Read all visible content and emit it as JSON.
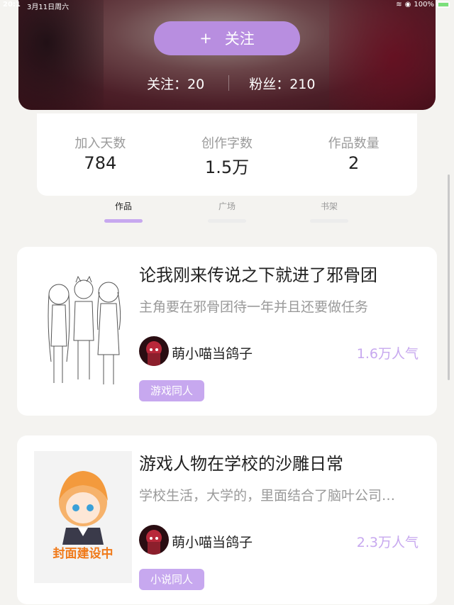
{
  "status": {
    "time": "20:1",
    "date": "3月11日周六",
    "battery": "100%"
  },
  "profile": {
    "follow_button": "关注",
    "following_label": "关注：20",
    "followers_label": "粉丝：210"
  },
  "stats": [
    {
      "label": "加入天数",
      "value": "784"
    },
    {
      "label": "创作字数",
      "value": "1.5万"
    },
    {
      "label": "作品数量",
      "value": "2"
    }
  ],
  "tabs": [
    {
      "label": "作品",
      "active": true
    },
    {
      "label": "广场",
      "active": false
    },
    {
      "label": "书架",
      "active": false
    }
  ],
  "works": [
    {
      "title": "论我刚来传说之下就进了邪骨团",
      "description": "主角要在邪骨团待一年并且还要做任务",
      "author": "萌小喵当鸽子",
      "popularity": "1.6万人气",
      "tag": "游戏同人"
    },
    {
      "title": "游戏人物在学校的沙雕日常",
      "description": "学校生活，大学的，里面结合了脑叶公司…",
      "author": "萌小喵当鸽子",
      "popularity": "2.3万人气",
      "tag": "小说同人",
      "cover_text": "封面建设中"
    }
  ],
  "colors": {
    "accent": "#c7a8ef",
    "button": "#b88ee0"
  }
}
